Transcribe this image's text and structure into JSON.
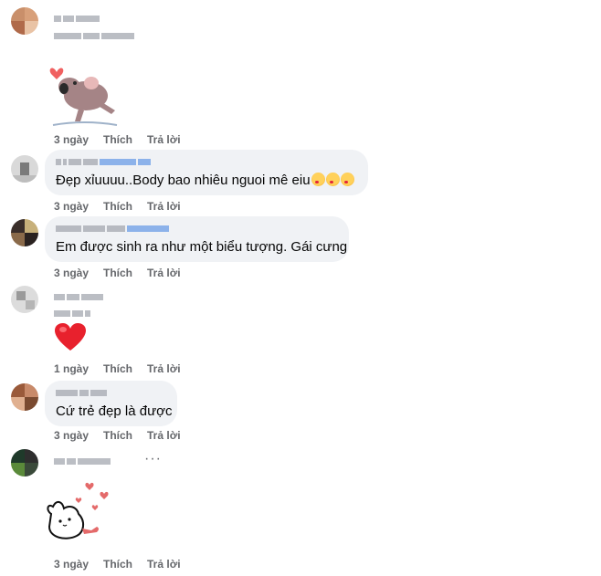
{
  "comments": [
    {
      "id": 1,
      "text": "",
      "has_sticker": "koala-sticker",
      "meta": {
        "time": "3 ngày",
        "like": "Thích",
        "reply": "Trả lời"
      }
    },
    {
      "id": 2,
      "text": "Đẹp xỉuuuu..Body bao nhiêu nguoi mê eiu",
      "emojis": [
        "face-blowing-kiss-icon",
        "face-blowing-kiss-icon",
        "face-blowing-kiss-icon"
      ],
      "meta": {
        "time": "3 ngày",
        "like": "Thích",
        "reply": "Trả lời"
      }
    },
    {
      "id": 3,
      "text": "Em được sinh ra như một biểu tượng. Gái cưng",
      "meta": {
        "time": "3 ngày",
        "like": "Thích",
        "reply": "Trả lời"
      }
    },
    {
      "id": 4,
      "text": "",
      "has_sticker": "red-heart-emoji",
      "meta": {
        "time": "1 ngày",
        "like": "Thích",
        "reply": "Trả lời"
      }
    },
    {
      "id": 5,
      "text": "Cứ trẻ đẹp là được",
      "meta": {
        "time": "3 ngày",
        "like": "Thích",
        "reply": "Trả lời"
      }
    },
    {
      "id": 6,
      "text": "",
      "more": "···",
      "has_sticker": "bunny-hearts-sticker",
      "meta": {
        "time": "3 ngày",
        "like": "Thích",
        "reply": "Trả lời"
      }
    }
  ],
  "colors": {
    "bubble": "#f0f2f5",
    "meta_text": "#65676b",
    "heart": "#e8212d"
  }
}
